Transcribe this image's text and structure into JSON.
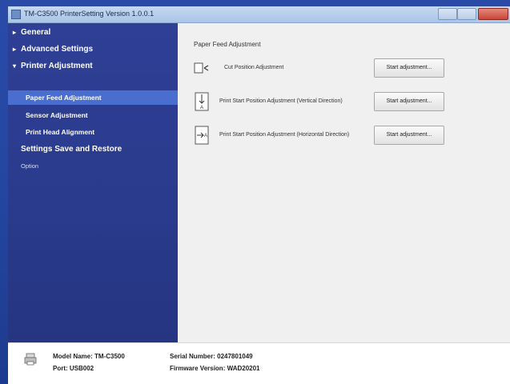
{
  "window": {
    "title": "TM-C3500 PrinterSetting Version 1.0.0.1"
  },
  "sidebar": {
    "items": [
      {
        "label": "General"
      },
      {
        "label": "Advanced Settings"
      },
      {
        "label": "Printer Adjustment"
      },
      {
        "label": "Paper Feed Adjustment"
      },
      {
        "label": "Sensor Adjustment"
      },
      {
        "label": "Print Head Alignment"
      },
      {
        "label": "Settings Save and Restore"
      },
      {
        "label": "Option"
      }
    ]
  },
  "content": {
    "section_title": "Paper Feed Adjustment",
    "rows": [
      {
        "label": "Cut Position Adjustment",
        "button": "Start adjustment..."
      },
      {
        "label": "Print Start Position Adjustment (Vertical Direction)",
        "button": "Start adjustment..."
      },
      {
        "label": "Print Start Position Adjustment (Horizontal Direction)",
        "button": "Start adjustment..."
      }
    ]
  },
  "footer": {
    "model_label": "Model Name: TM-C3500",
    "port_label": "Port: USB002",
    "serial_label": "Serial Number: 0247801049",
    "firmware_label": "Firmware Version: WAD20201"
  },
  "colors": {
    "sidebar_bg": "#2e3f95",
    "selected_bg": "#4a6ed0",
    "content_bg": "#f0f0f0",
    "desktop_bg": "#2446a0"
  }
}
